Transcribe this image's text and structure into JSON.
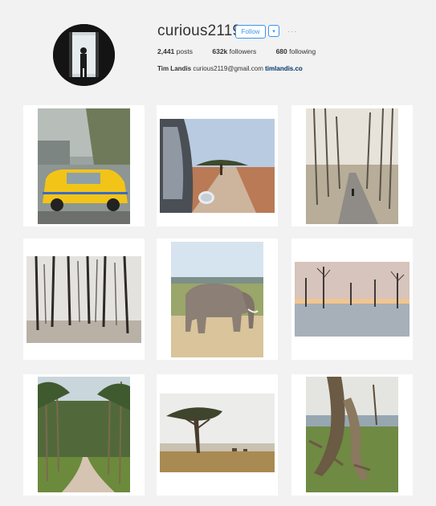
{
  "profile": {
    "username": "curious2119",
    "follow_label": "Follow",
    "dropdown_icon": "▾",
    "more_icon": "···",
    "posts_count": "2,441",
    "posts_label": "posts",
    "followers_count": "632k",
    "followers_label": "followers",
    "following_count": "680",
    "following_label": "following",
    "full_name": "Tim Landis",
    "email": "curious2119@gmail.com",
    "website": "timlandis.co"
  },
  "colors": {
    "accent": "#3897f0",
    "background": "#f2f2f2",
    "tile": "#ffffff"
  },
  "posts": [
    {
      "subject": "yellow taxi through rainy window"
    },
    {
      "subject": "car mirror acacia tree road"
    },
    {
      "subject": "person walking tree lined road"
    },
    {
      "subject": "bare forest trees"
    },
    {
      "subject": "elephant on savanna"
    },
    {
      "subject": "dead trees in lake at sunset"
    },
    {
      "subject": "dirt road through acacia forest"
    },
    {
      "subject": "acacia tree with grazing animals"
    },
    {
      "subject": "twisted tree trunk closeup"
    }
  ]
}
